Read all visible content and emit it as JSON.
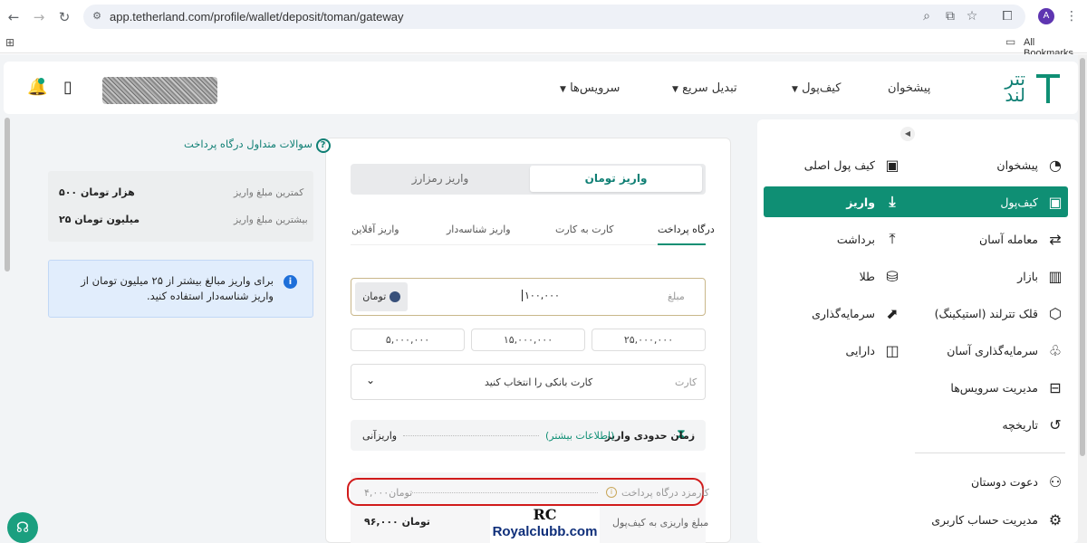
{
  "browser": {
    "url": "app.tetherland.com/profile/wallet/deposit/toman/gateway",
    "all_bookmarks": "All Bookmarks",
    "avatar_letter": "A"
  },
  "header": {
    "logo_top": "تتر",
    "logo_bottom": "لند",
    "menu": [
      "پیشخوان",
      "کیف‌پول",
      "تبدیل سریع",
      "سرویس‌ها"
    ]
  },
  "sidebar": {
    "right_items": [
      "پیشخوان",
      "کیف‌پول",
      "معامله آسان",
      "بازار",
      "قلک تترلند (استیکینگ)",
      "سرمایه‌گذاری آسان",
      "مدیریت سرویس‌ها",
      "تاریخچه"
    ],
    "left_items": [
      "کیف پول اصلی",
      "واریز",
      "برداشت",
      "طلا",
      "سرمایه‌گذاری",
      "دارایی"
    ],
    "bottom_items": [
      "دعوت دوستان",
      "مدیریت حساب کاربری"
    ]
  },
  "deposit": {
    "tab_toman": "واریز تومان",
    "tab_crypto": "واریز رمزارز",
    "subtabs": [
      "درگاه پرداخت",
      "کارت به کارت",
      "واریز شناسه‌دار",
      "واریز آفلاین"
    ],
    "amount_label": "مبلغ",
    "amount_value": "۱۰۰,۰۰۰",
    "currency": "تومان",
    "presets": [
      "۲۵,۰۰۰,۰۰۰",
      "۱۵,۰۰۰,۰۰۰",
      "۵,۰۰۰,۰۰۰"
    ],
    "card_label": "کارت",
    "card_placeholder": "کارت بانکی را انتخاب کنید",
    "time_label": "زمان حدودی واریز",
    "time_more": "(اطلاعات بیشتر)",
    "time_value": "واریزآنی",
    "fee_label": "کارمزد درگاه پرداخت",
    "fee_value": "۴,۰۰۰تومان",
    "net_label": "مبلغ واریزی به کیف‌پول",
    "net_value": "۹۶,۰۰۰ تومان"
  },
  "left_panel": {
    "faq": "سوالات متداول درگاه پرداخت",
    "min_label": "کمترین مبلغ واریز",
    "min_value": "۵۰۰ هزار تومان",
    "max_label": "بیشترین مبلغ واریز",
    "max_value": "۲۵ میلیون تومان",
    "info": "برای واریز مبالغ بیشتر از ۲۵ میلیون تومان از واریز شناسه‌دار استفاده کنید."
  },
  "watermark": {
    "logo": "RC",
    "text": "Royalclubb.com"
  },
  "colors": {
    "brand": "#0f8f74",
    "highlight": "#d11b1b",
    "info_bg": "#e1edfc"
  }
}
